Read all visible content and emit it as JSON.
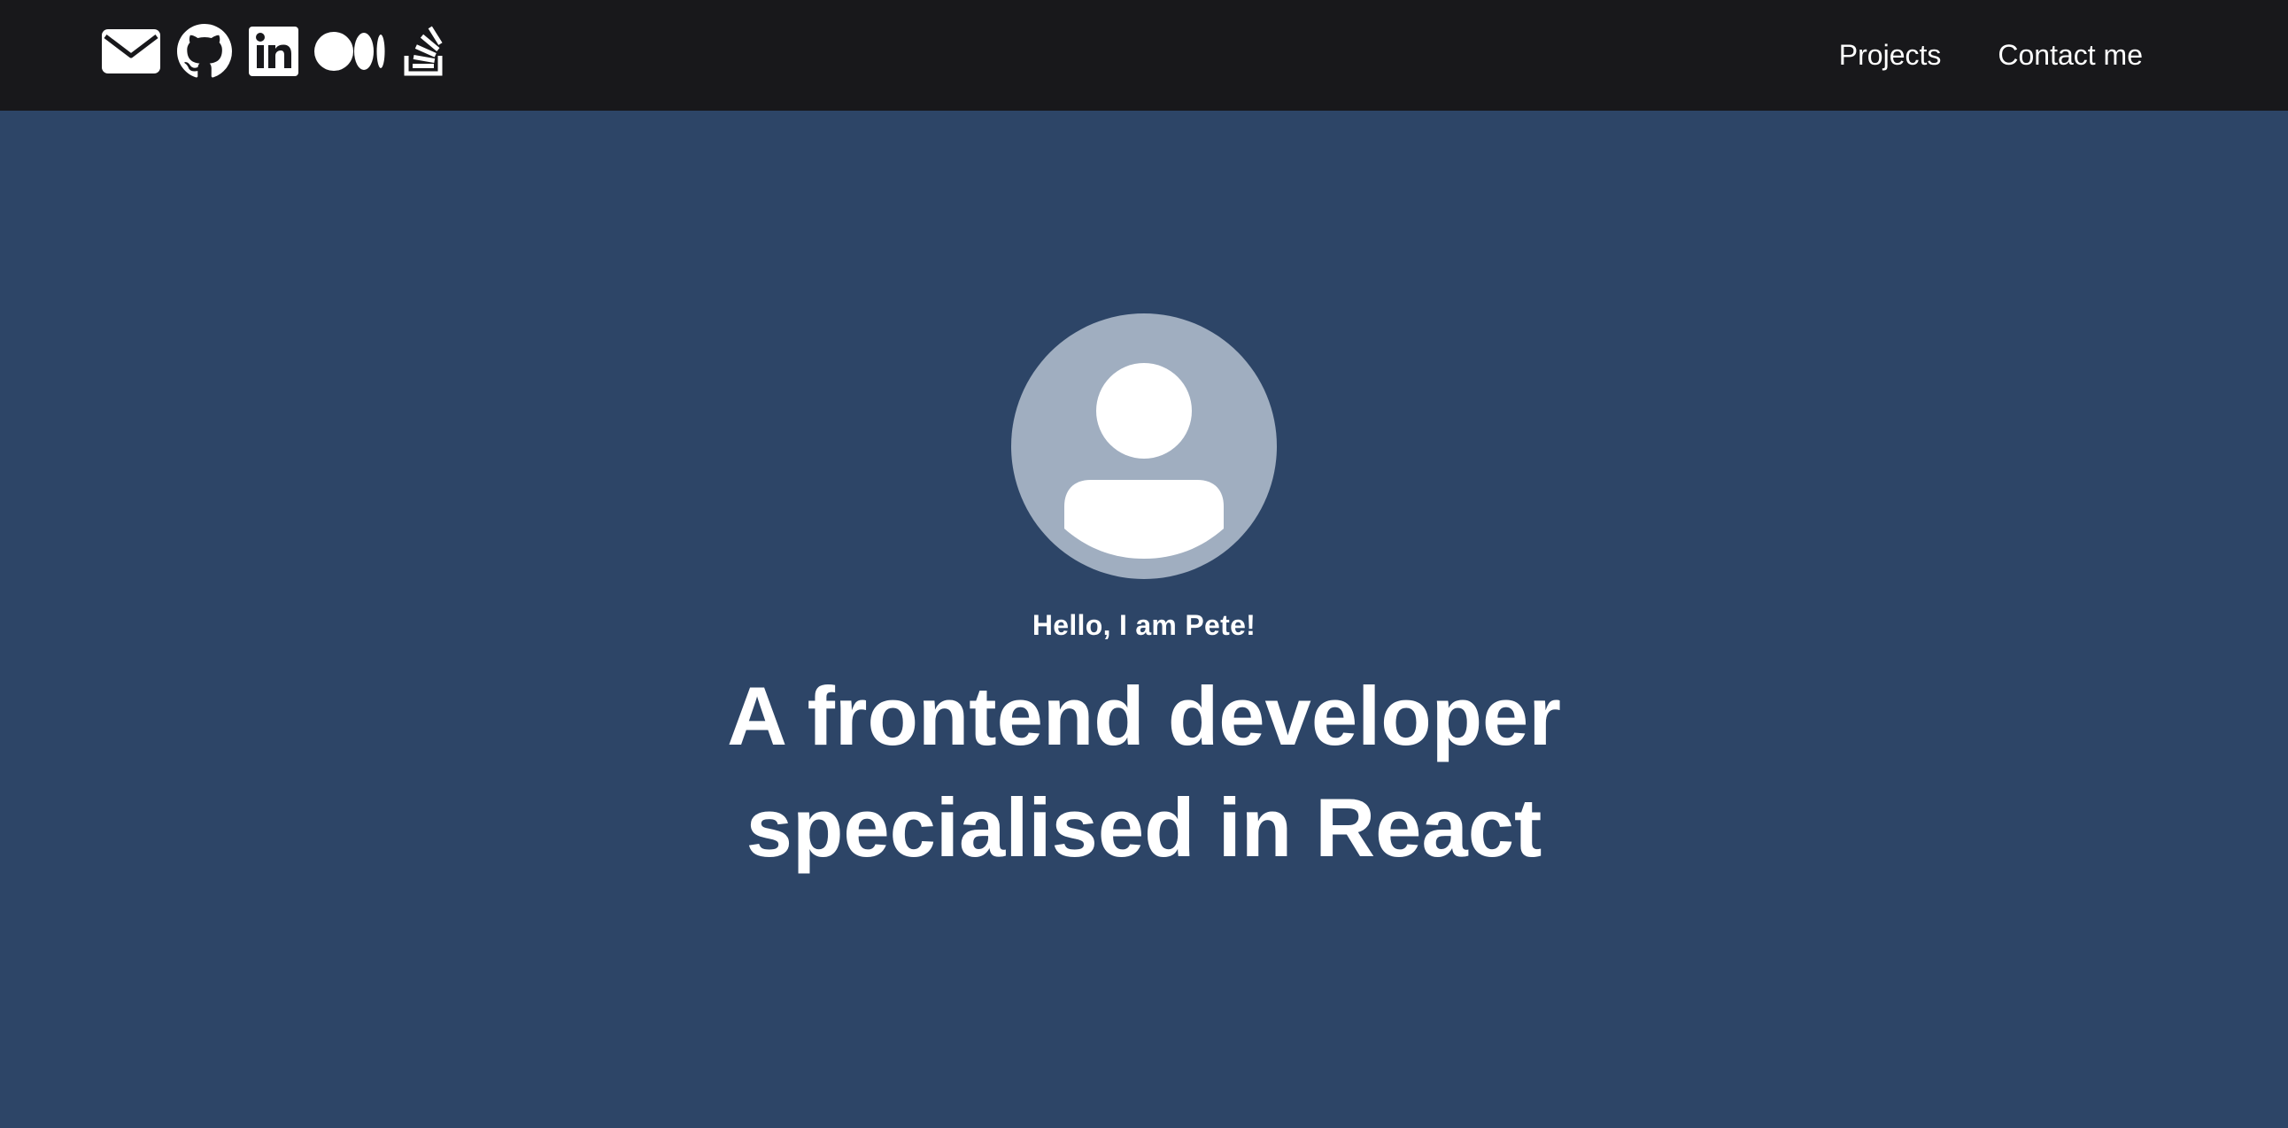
{
  "header": {
    "social_icons": [
      {
        "name": "email-icon"
      },
      {
        "name": "github-icon"
      },
      {
        "name": "linkedin-icon"
      },
      {
        "name": "medium-icon"
      },
      {
        "name": "stackoverflow-icon"
      }
    ],
    "nav": {
      "projects_label": "Projects",
      "contact_label": "Contact me"
    }
  },
  "hero": {
    "avatar_icon": "user-avatar-icon",
    "greeting": "Hello, I am Pete!",
    "headline_line1": "A frontend developer",
    "headline_line2": "specialised in React"
  },
  "colors": {
    "header_bg": "#18181b",
    "page_bg": "#2d4567",
    "avatar_bg": "#a0aec0",
    "text": "#ffffff"
  }
}
